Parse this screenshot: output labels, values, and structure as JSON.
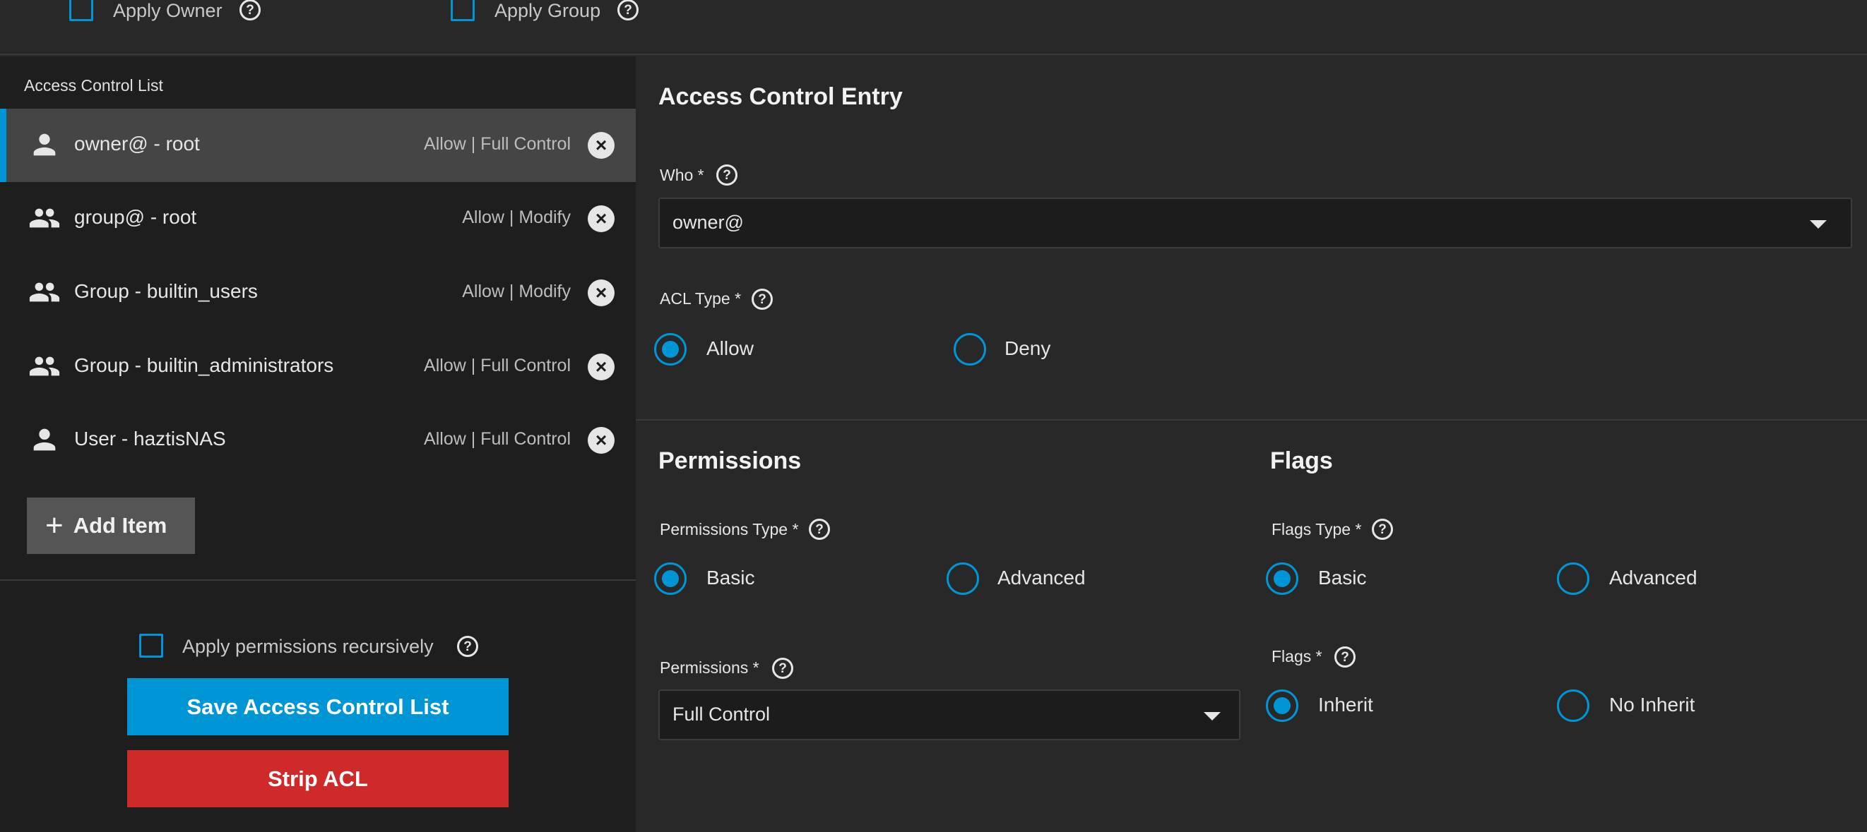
{
  "top": {
    "apply_owner": "Apply Owner",
    "apply_group": "Apply Group"
  },
  "acl_list": {
    "title": "Access Control List",
    "items": [
      {
        "name": "owner@ - root",
        "perm": "Allow | Full Control",
        "icon": "person-icon"
      },
      {
        "name": "group@ - root",
        "perm": "Allow | Modify",
        "icon": "group-icon"
      },
      {
        "name": "Group - builtin_users",
        "perm": "Allow | Modify",
        "icon": "group-icon"
      },
      {
        "name": "Group - builtin_administrators",
        "perm": "Allow | Full Control",
        "icon": "group-icon"
      },
      {
        "name": "User - haztisNAS",
        "perm": "Allow | Full Control",
        "icon": "person-icon"
      }
    ],
    "add_item": "Add Item",
    "apply_recursive": "Apply permissions recursively",
    "save": "Save Access Control List",
    "strip": "Strip ACL"
  },
  "entry": {
    "title": "Access Control Entry",
    "who_label": "Who *",
    "who_value": "owner@",
    "acl_type_label": "ACL Type *",
    "allow": "Allow",
    "deny": "Deny"
  },
  "permissions": {
    "title": "Permissions",
    "type_label": "Permissions Type *",
    "basic": "Basic",
    "advanced": "Advanced",
    "perm_label": "Permissions *",
    "perm_value": "Full Control"
  },
  "flags": {
    "title": "Flags",
    "type_label": "Flags Type *",
    "basic": "Basic",
    "advanced": "Advanced",
    "flags_label": "Flags *",
    "inherit": "Inherit",
    "no_inherit": "No Inherit"
  },
  "colors": {
    "accent": "#0095d5",
    "danger": "#cf2a2a"
  }
}
